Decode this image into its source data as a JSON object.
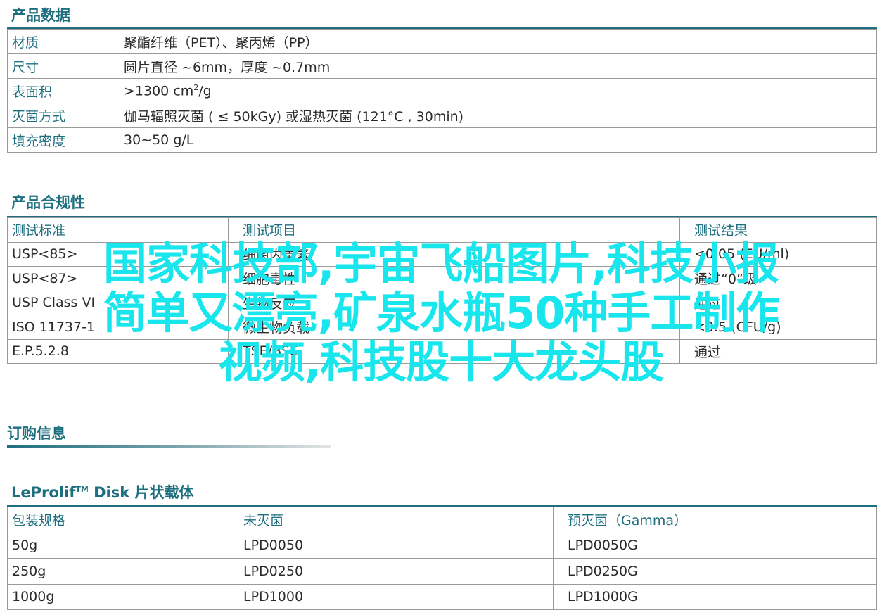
{
  "product_data": {
    "title": "产品数据",
    "rows": [
      {
        "label": "材质",
        "value": "聚酯纤维（PET）、聚丙烯（PP）"
      },
      {
        "label": "尺寸",
        "value": "圆片直径 ~6mm，厚度 ~0.7mm"
      },
      {
        "label": "表面积",
        "value_pre": ">1300 cm",
        "value_sup": "2",
        "value_post": "/g"
      },
      {
        "label": "灭菌方式",
        "value": "伽马辐照灭菌 ( ≤ 50kGy) 或湿热灭菌 (121°C , 30min)"
      },
      {
        "label": "填充密度",
        "value": "30~50 g/L"
      }
    ]
  },
  "compliance": {
    "title": "产品合规性",
    "headers": [
      "测试标准",
      "测试项目",
      "测试结果"
    ],
    "rows": [
      [
        "USP<85>",
        "细菌内毒素",
        "<0.05 (EU/ml)"
      ],
      [
        "USP<87>",
        "细胞毒性",
        "通过“0”级"
      ],
      [
        "USP Class VI",
        "生物反应",
        "通过"
      ],
      [
        "ISO 11737-1",
        "微生物负载",
        "<0.5 (CFU/g)"
      ],
      [
        "E.P.5.2.8",
        "TSE/BSE",
        "通过"
      ]
    ]
  },
  "ordering": {
    "title": "订购信息",
    "product_pre": "LeProlif",
    "product_tm": "TM",
    "product_post": " Disk 片状载体",
    "headers": [
      "包装规格",
      "未灭菌",
      "预灭菌（Gamma）"
    ],
    "rows": [
      [
        "50g",
        "LPD0050",
        "LPD0050G"
      ],
      [
        "250g",
        "LPD0250",
        "LPD0250G"
      ],
      [
        "1000g",
        "LPD1000",
        "LPD1000G"
      ]
    ]
  },
  "watermark": {
    "line1": "国家科技部,宇宙飞船图片,科技小报",
    "line2": "简单又漂亮,矿泉水瓶50种手工制作",
    "line3": "视频,科技股十大龙头股"
  },
  "colors": {
    "accent": "#1d6f80",
    "overlay": "#19e6ec",
    "border": "#9a9a9a"
  }
}
